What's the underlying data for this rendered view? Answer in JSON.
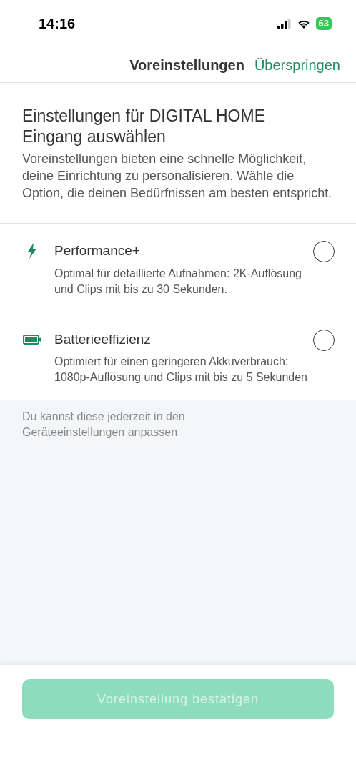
{
  "status_bar": {
    "time": "14:16",
    "battery": "63"
  },
  "header": {
    "title": "Voreinstellungen",
    "skip": "Überspringen"
  },
  "intro": {
    "title": "Einstellungen für DIGITAL HOME Eingang auswählen",
    "text": "Voreinstellungen bieten eine schnelle Möglichkeit, deine Einrichtung zu personalisieren. Wähle die Option, die deinen Bedürfnissen am besten entspricht."
  },
  "options": [
    {
      "kind": "bolt",
      "title": "Performance+",
      "text": "Optimal für detaillierte Aufnahmen: 2K-Auflösung und Clips mit bis zu 30 Sekunden.",
      "selected": false
    },
    {
      "kind": "battery",
      "title": "Batterieeffizienz",
      "text": "Optimiert für einen geringeren Akkuverbrauch: 1080p-Auflösung und Clips mit bis zu 5 Sekunden",
      "selected": false
    }
  ],
  "note": "Du kannst diese jederzeit in den Geräteeinstellungen anpassen",
  "confirm": {
    "label": "Voreinstellung bestätigen",
    "disabled": true
  }
}
